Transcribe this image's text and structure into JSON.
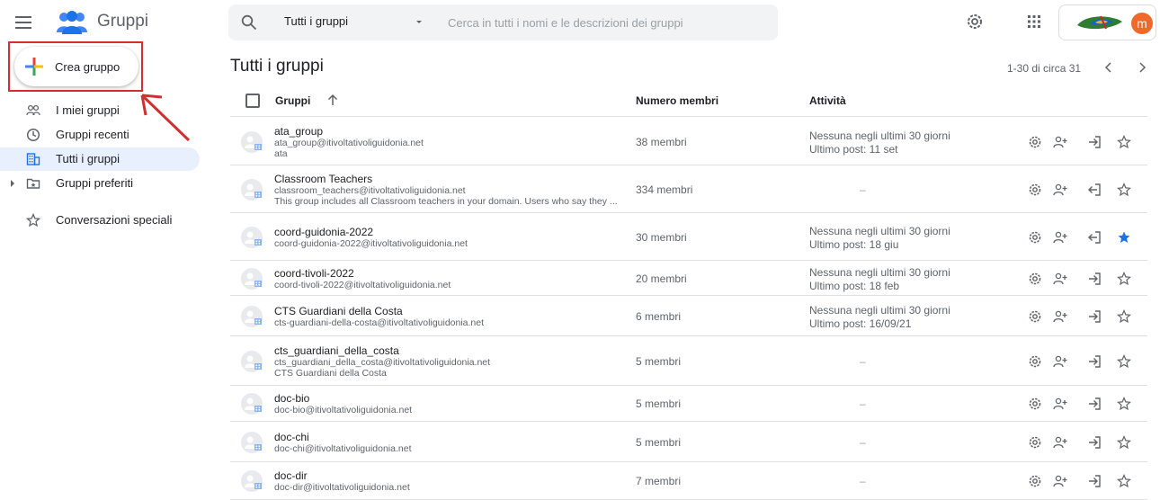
{
  "header": {
    "app_title": "Gruppi",
    "search_scope": "Tutti i gruppi",
    "search_placeholder": "Cerca in tutti i nomi e le descrizioni dei gruppi",
    "avatar_letter": "m"
  },
  "sidebar": {
    "create_label": "Crea gruppo",
    "items": [
      {
        "label": "I miei gruppi",
        "icon": "people-icon"
      },
      {
        "label": "Gruppi recenti",
        "icon": "clock-icon"
      },
      {
        "label": "Tutti i gruppi",
        "icon": "building-icon",
        "active": true
      },
      {
        "label": "Gruppi preferiti",
        "icon": "folder-star-icon"
      },
      {
        "label": "Conversazioni speciali",
        "icon": "star-outline-icon"
      }
    ]
  },
  "main": {
    "title": "Tutti i gruppi",
    "pagination": "1-30 di circa 31",
    "columns": {
      "name": "Gruppi",
      "members": "Numero membri",
      "activity": "Attività"
    },
    "rows": [
      {
        "name": "ata_group",
        "email": "ata_group@itivoltativoliguidonia.net",
        "desc": "ata",
        "members": "38 membri",
        "act1": "Nessuna negli ultimi 30 giorni",
        "act2": "Ultimo post: 11 set",
        "joined": false,
        "starred": false
      },
      {
        "name": "Classroom Teachers",
        "email": "classroom_teachers@itivoltativoliguidonia.net",
        "desc": "This group includes all Classroom teachers in your domain. Users who say they ...",
        "members": "334 membri",
        "act1": "",
        "act2": "",
        "dash": "–",
        "joined": true,
        "starred": false
      },
      {
        "name": "coord-guidonia-2022",
        "email": "coord-guidonia-2022@itivoltativoliguidonia.net",
        "desc": "",
        "members": "30 membri",
        "act1": "Nessuna negli ultimi 30 giorni",
        "act2": "Ultimo post: 18 giu",
        "joined": true,
        "starred": true
      },
      {
        "name": "coord-tivoli-2022",
        "email": "coord-tivoli-2022@itivoltativoliguidonia.net",
        "desc": "",
        "members": "20 membri",
        "act1": "Nessuna negli ultimi 30 giorni",
        "act2": "Ultimo post: 18 feb",
        "joined": false,
        "starred": false
      },
      {
        "name": "CTS Guardiani della Costa",
        "email": "cts-guardiani-della-costa@itivoltativoliguidonia.net",
        "desc": "",
        "members": "6 membri",
        "act1": "Nessuna negli ultimi 30 giorni",
        "act2": "Ultimo post: 16/09/21",
        "joined": false,
        "starred": false
      },
      {
        "name": "cts_guardiani_della_costa",
        "email": "cts_guardiani_della_costa@itivoltativoliguidonia.net",
        "desc": "CTS Guardiani della Costa",
        "members": "5 membri",
        "act1": "",
        "act2": "",
        "dash": "–",
        "joined": false,
        "starred": false
      },
      {
        "name": "doc-bio",
        "email": "doc-bio@itivoltativoliguidonia.net",
        "desc": "",
        "members": "5 membri",
        "act1": "",
        "act2": "",
        "dash": "–",
        "joined": false,
        "starred": false
      },
      {
        "name": "doc-chi",
        "email": "doc-chi@itivoltativoliguidonia.net",
        "desc": "",
        "members": "5 membri",
        "act1": "",
        "act2": "",
        "dash": "–",
        "joined": false,
        "starred": false
      },
      {
        "name": "doc-dir",
        "email": "doc-dir@itivoltativoliguidonia.net",
        "desc": "",
        "members": "7 membri",
        "act1": "",
        "act2": "",
        "dash": "–",
        "joined": false,
        "starred": false
      }
    ]
  },
  "colors": {
    "accent": "#1a73e8",
    "active_nav": "#e8f0fe",
    "annotation": "#d32f2f",
    "avatar": "#f0692a"
  }
}
